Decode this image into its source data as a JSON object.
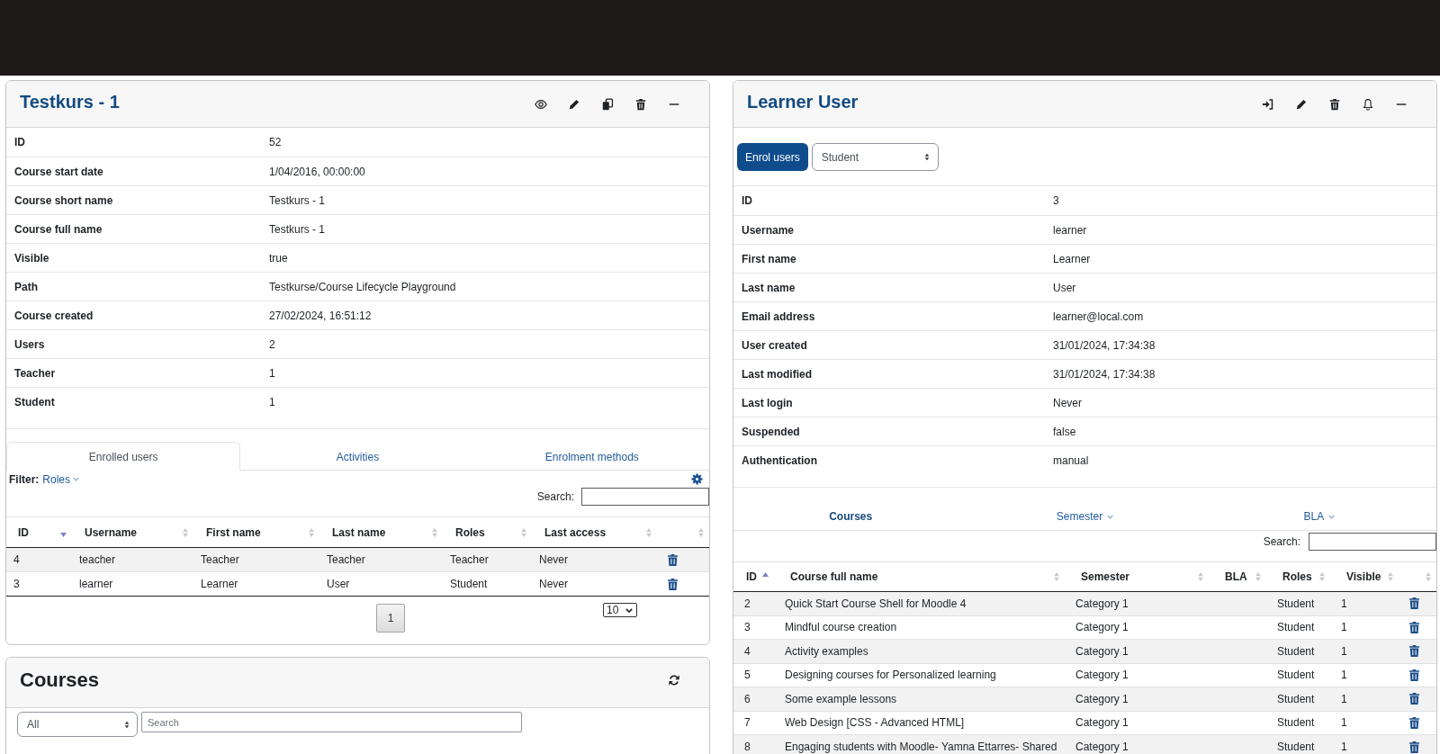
{
  "course_panel": {
    "title": "Testkurs - 1",
    "details": [
      {
        "label": "ID",
        "value": "52"
      },
      {
        "label": "Course start date",
        "value": "1/04/2016, 00:00:00"
      },
      {
        "label": "Course short name",
        "value": "Testkurs - 1"
      },
      {
        "label": "Course full name",
        "value": "Testkurs - 1"
      },
      {
        "label": "Visible",
        "value": "true"
      },
      {
        "label": "Path",
        "value": "Testkurse/Course Lifecycle Playground"
      },
      {
        "label": "Course created",
        "value": "27/02/2024, 16:51:12"
      },
      {
        "label": "Users",
        "value": "2"
      },
      {
        "label": "Teacher",
        "value": "1"
      },
      {
        "label": "Student",
        "value": "1"
      }
    ],
    "tabs": [
      {
        "label": "Enrolled users",
        "selected": true
      },
      {
        "label": "Activities",
        "selected": false
      },
      {
        "label": "Enrolment methods",
        "selected": false
      }
    ],
    "filter": {
      "label": "Filter:",
      "value": "Roles"
    },
    "search": {
      "label": "Search:"
    },
    "table": {
      "columns": [
        {
          "label": "ID",
          "kind": "descending"
        },
        {
          "label": "Username",
          "kind": "unsorted"
        },
        {
          "label": "First name",
          "kind": "unsorted"
        },
        {
          "label": "Last name",
          "kind": "unsorted"
        },
        {
          "label": "Roles",
          "kind": "unsorted"
        },
        {
          "label": "Last access",
          "kind": "unsorted"
        },
        {
          "kind": "unsorted"
        }
      ],
      "rows": [
        {
          "id": "4",
          "username": "teacher",
          "first_name": "Teacher",
          "last_name": "Teacher",
          "roles": "Teacher",
          "last_access": "Never"
        },
        {
          "id": "3",
          "username": "learner",
          "first_name": "Learner",
          "last_name": "User",
          "roles": "Student",
          "last_access": "Never"
        }
      ]
    },
    "pages": [
      "1"
    ],
    "page_size": "10"
  },
  "courses_panel": {
    "title": "Courses",
    "category": "All",
    "search": {
      "placeholder": "Search"
    }
  },
  "user_panel": {
    "title": "Learner User",
    "enrol_button": "Enrol users",
    "role": "Student",
    "details": [
      {
        "label": "ID",
        "value": "3"
      },
      {
        "label": "Username",
        "value": "learner"
      },
      {
        "label": "First name",
        "value": "Learner"
      },
      {
        "label": "Last name",
        "value": "User"
      },
      {
        "label": "Email address",
        "value": "learner@local.com"
      },
      {
        "label": "User created",
        "value": "31/01/2024, 17:34:38"
      },
      {
        "label": "Last modified",
        "value": "31/01/2024, 17:34:38"
      },
      {
        "label": "Last login",
        "value": "Never"
      },
      {
        "label": "Suspended",
        "value": "false"
      },
      {
        "label": "Authentication",
        "value": "manual"
      }
    ],
    "tabs": [
      {
        "label": "Courses",
        "selected": true,
        "dropdown": false
      },
      {
        "label": "Semester",
        "selected": false,
        "dropdown": true
      },
      {
        "label": "BLA",
        "selected": false,
        "dropdown": true
      }
    ],
    "search": {
      "label": "Search:"
    },
    "table": {
      "columns": [
        {
          "label": "ID",
          "kind": "ascending"
        },
        {
          "label": "Course full name",
          "kind": "unsorted"
        },
        {
          "label": "Semester",
          "kind": "unsorted"
        },
        {
          "label": "BLA",
          "kind": "unsorted"
        },
        {
          "label": "Roles",
          "kind": "unsorted"
        },
        {
          "label": "Visible",
          "kind": "unsorted"
        },
        {
          "kind": "unsorted"
        }
      ],
      "rows": [
        {
          "id": "2",
          "name": "Quick Start Course Shell for Moodle 4",
          "semester": "Category 1",
          "roles": "Student",
          "visible": "1"
        },
        {
          "id": "3",
          "name": "Mindful course creation",
          "semester": "Category 1",
          "roles": "Student",
          "visible": "1"
        },
        {
          "id": "4",
          "name": "Activity examples",
          "semester": "Category 1",
          "roles": "Student",
          "visible": "1"
        },
        {
          "id": "5",
          "name": "Designing courses for Personalized learning",
          "semester": "Category 1",
          "roles": "Student",
          "visible": "1"
        },
        {
          "id": "6",
          "name": "Some example lessons",
          "semester": "Category 1",
          "roles": "Student",
          "visible": "1"
        },
        {
          "id": "7",
          "name": "Web Design [CSS - Advanced HTML]",
          "semester": "Category 1",
          "roles": "Student",
          "visible": "1"
        },
        {
          "id": "8",
          "name": "Engaging students with Moodle- Yamna Ettarres- Shared",
          "semester": "Category 1",
          "roles": "Student",
          "visible": "1"
        }
      ]
    }
  }
}
